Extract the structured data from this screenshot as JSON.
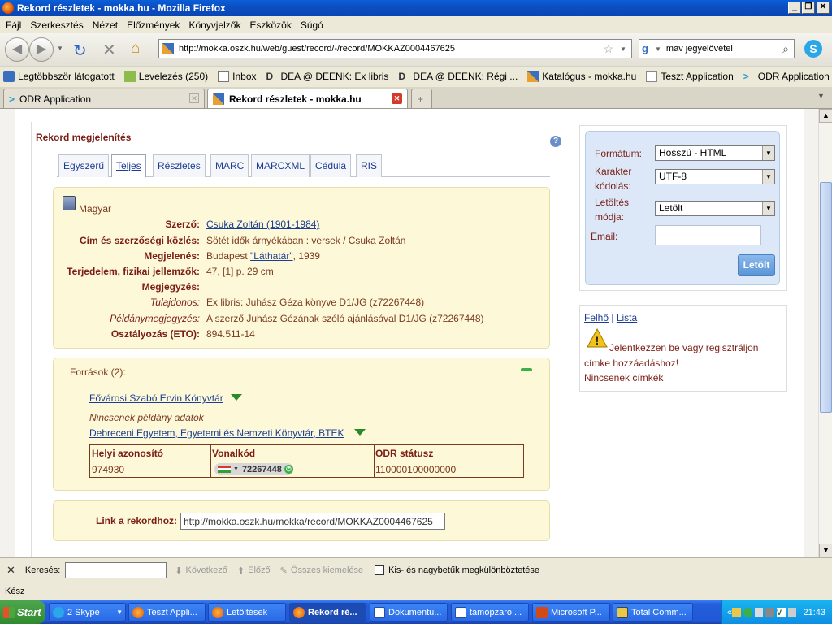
{
  "window": {
    "title": "Rekord részletek - mokka.hu - Mozilla Firefox"
  },
  "menu": [
    "Fájl",
    "Szerkesztés",
    "Nézet",
    "Előzmények",
    "Könyvjelzők",
    "Eszközök",
    "Súgó"
  ],
  "nav": {
    "url": "http://mokka.oszk.hu/web/guest/record/-/record/MOKKAZ0004467625",
    "search_value": "mav jegyelővétel"
  },
  "bookmarks": [
    "Legtöbbször látogatott",
    "Levelezés (250)",
    "Inbox",
    "DEA @ DEENK: Ex libris",
    "DEA @ DEENK: Régi ...",
    "Katalógus - mokka.hu",
    "Teszt Application",
    "ODR Application"
  ],
  "tabs": [
    {
      "label": "ODR Application"
    },
    {
      "label": "Rekord részletek - mokka.hu"
    }
  ],
  "record": {
    "heading": "Rekord megjelenítés",
    "view_tabs": [
      "Egyszerű",
      "Teljes",
      "Részletes",
      "MARC",
      "MARCXML",
      "Cédula",
      "RIS"
    ],
    "language": "Magyar",
    "fields": [
      {
        "label": "Szerző:",
        "value": "Csuka Zoltán (1901-1984)",
        "link": true
      },
      {
        "label": "Cím és szerzőségi közlés:",
        "value": "Sötét idők árnyékában : versek / Csuka Zoltán"
      },
      {
        "label": "Megjelenés:",
        "value_pre": "Budapest ",
        "value_link": "\"Láthatár\"",
        "value_post": ", 1939"
      },
      {
        "label": "Terjedelem, fizikai jellemzők:",
        "value": "47, [1] p. 29 cm"
      },
      {
        "label": "Megjegyzés:",
        "value": ""
      },
      {
        "label": "Tulajdonos:",
        "value": "Ex libris: Juhász Géza könyve D1/JG (z72267448)",
        "italic": true
      },
      {
        "label": "Példánymegjegyzés:",
        "value": "A szerző Juhász Gézának szóló ajánlásával D1/JG (z72267448)",
        "italic": true
      },
      {
        "label": "Osztályozás (ETO):",
        "value": "894.511-14"
      }
    ],
    "sources": {
      "title": "Források (2):",
      "libraries": [
        "Fővárosi Szabó Ervin Könyvtár",
        "Debreceni Egyetem, Egyetemi és Nemzeti Könyvtár, BTEK"
      ],
      "no_copy": "Nincsenek példány adatok",
      "columns": [
        "Helyi azonosító",
        "Vonalkód",
        "ODR státusz"
      ],
      "row": {
        "local_id": "974930",
        "barcode": "72267448",
        "odr_status": "110000100000000"
      }
    },
    "permalink": {
      "label": "Link a rekordhoz:",
      "value": "http://mokka.oszk.hu/mokka/record/MOKKAZ0004467625"
    }
  },
  "export": {
    "format_label": "Formátum:",
    "format_value": "Hosszú - HTML",
    "encoding_label": "Karakter kódolás:",
    "encoding_value": "UTF-8",
    "mode_label": "Letöltés módja:",
    "mode_value": "Letölt",
    "email_label": "Email:",
    "email_value": "",
    "button": "Letölt"
  },
  "tags": {
    "cloud": "Felhő",
    "sep": "|",
    "list": "Lista",
    "message": "Jelentkezzen be vagy regisztráljon címke hozzáadáshoz!",
    "none": "Nincsenek címkék"
  },
  "findbar": {
    "label": "Keresés:",
    "next": "Következő",
    "prev": "Előző",
    "highlight": "Összes kiemelése",
    "case": "Kis- és nagybetűk megkülönböztetése"
  },
  "status": "Kész",
  "taskbar": {
    "start": "Start",
    "items": [
      "2 Skype",
      "Teszt Appli...",
      "Letöltések",
      "Rekord ré...",
      "Dokumentu...",
      "tamopzaro....",
      "Microsoft P...",
      "Total Comm..."
    ],
    "clock": "21:43"
  }
}
